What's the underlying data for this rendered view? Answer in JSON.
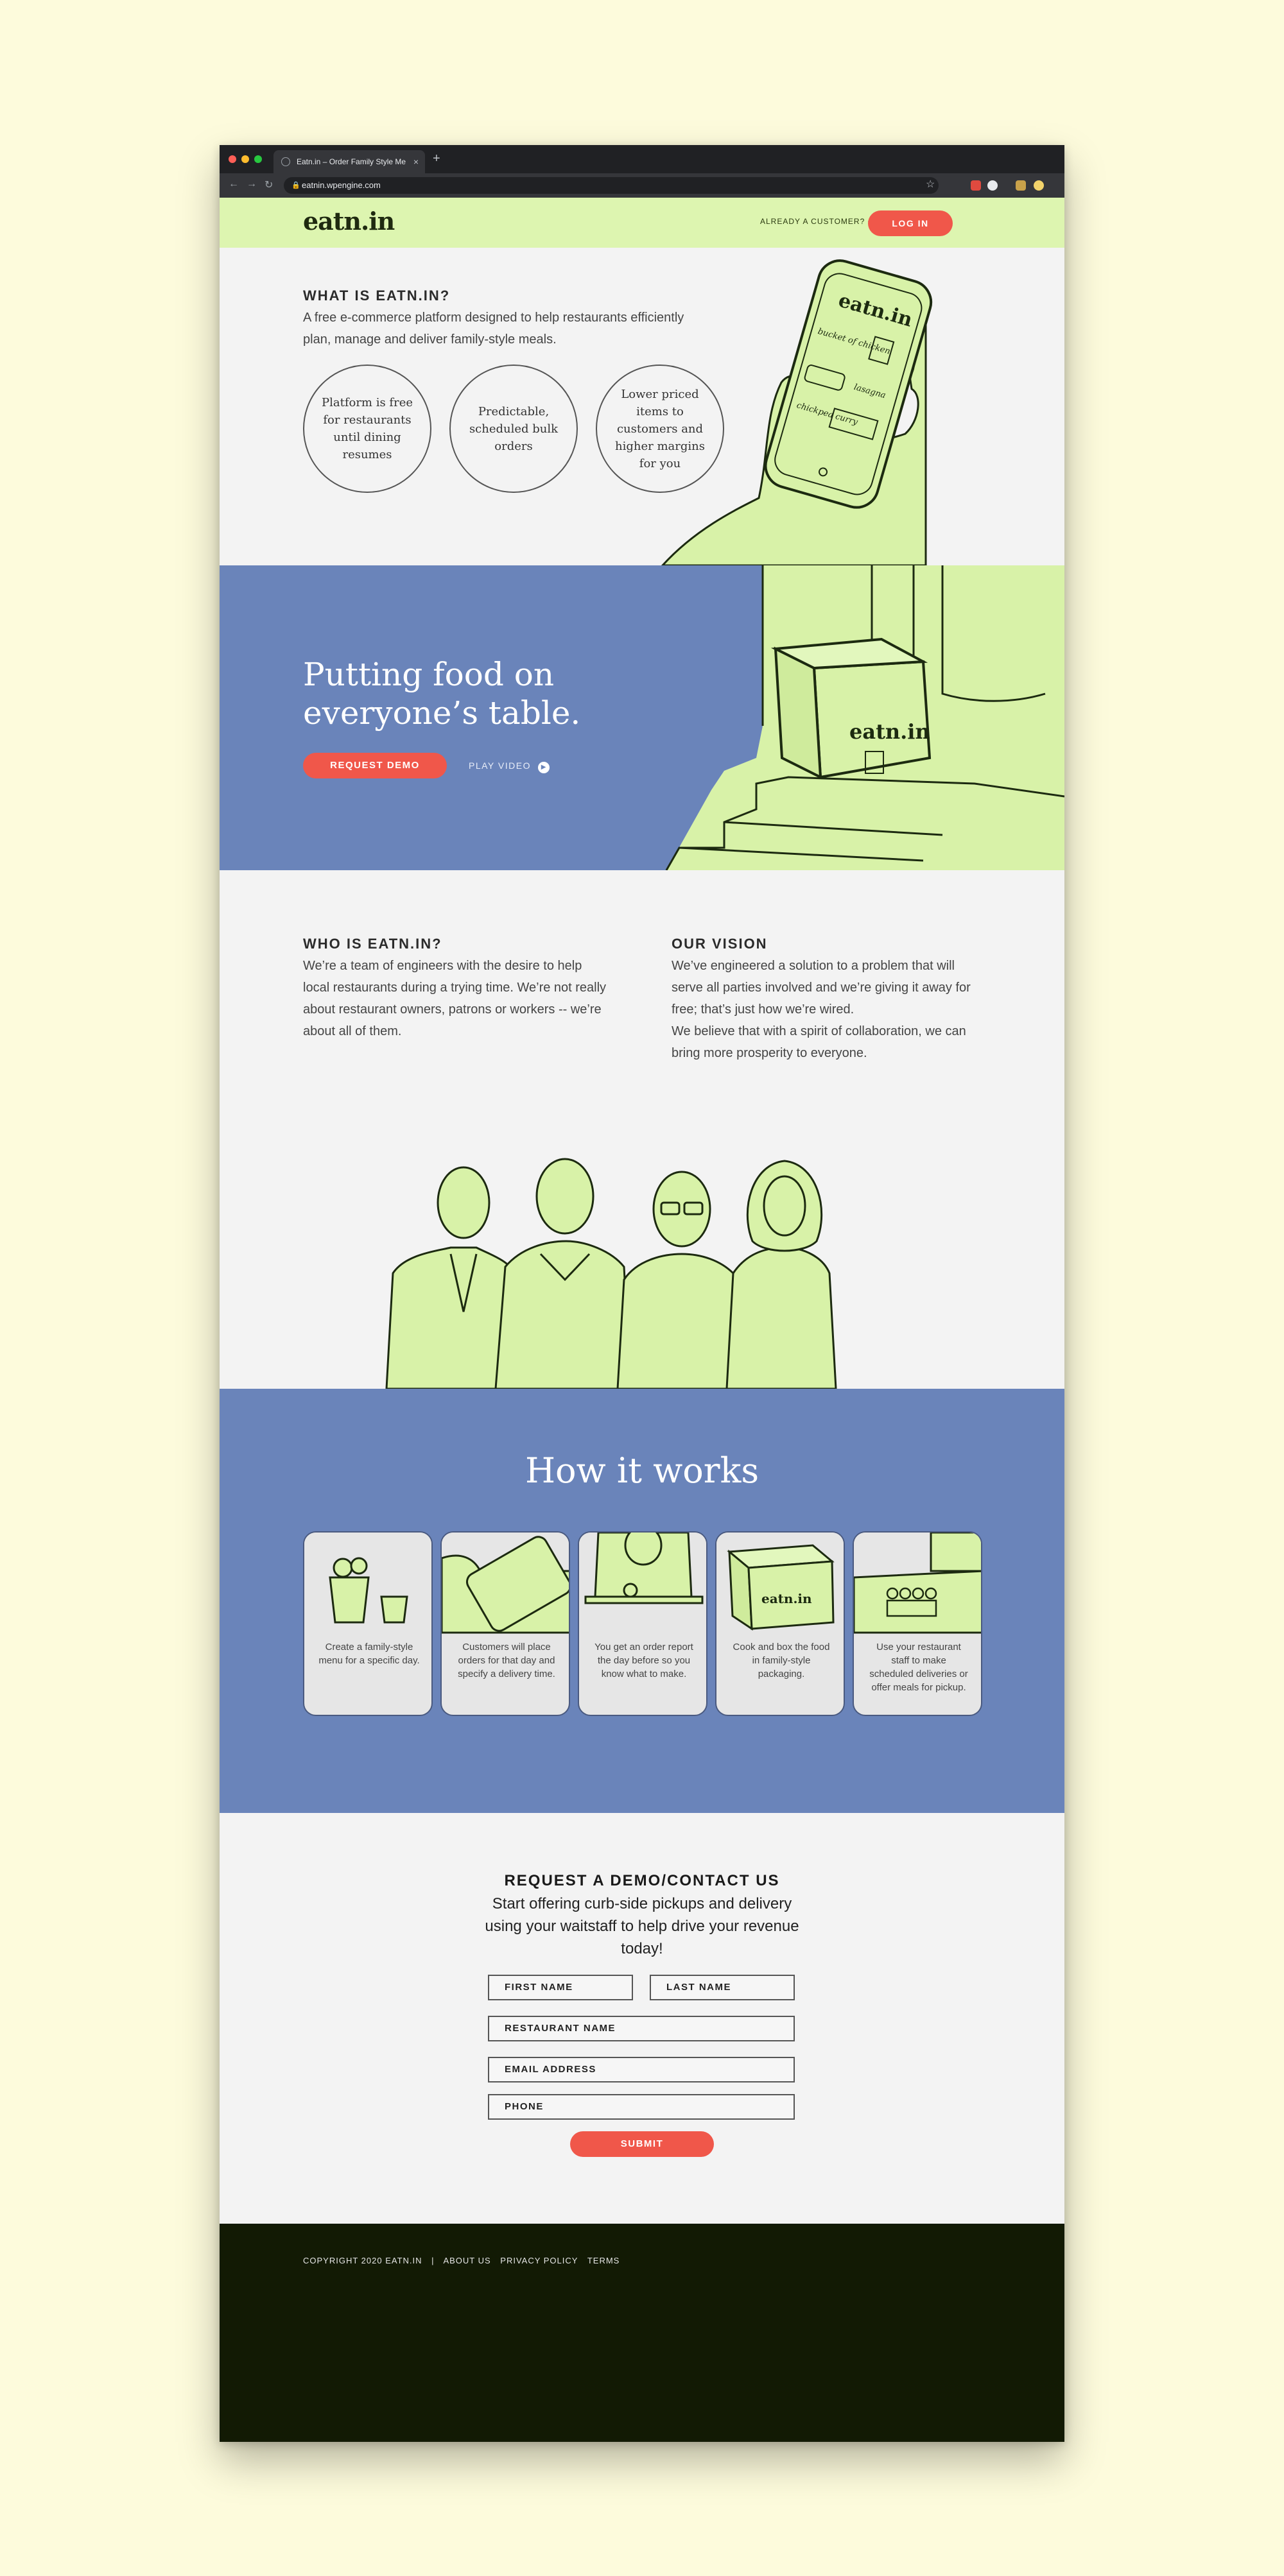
{
  "browser": {
    "tab_title": "Eatn.in – Order Family Style Me",
    "tab_close": "×",
    "new_tab": "+",
    "url": "eatnin.wpengine.com"
  },
  "header": {
    "logo": "eatn.in",
    "already_customer": "ALREADY A CUSTOMER?",
    "login": "LOG IN"
  },
  "what": {
    "heading": "WHAT IS EATN.IN?",
    "description": "A free e-commerce platform designed to help restaurants efficiently plan, manage and deliver family-style meals.",
    "circles": [
      "Platform is free for restaurants until dining resumes",
      "Predictable, scheduled bulk orders",
      "Lower priced items to customers and higher margins for you"
    ],
    "phone": {
      "logo": "eatn.in",
      "item1": "bucket of chicken",
      "item2": "lasagna",
      "item3": "chickpea curry"
    }
  },
  "hero": {
    "title": "Putting food on everyone’s table.",
    "request_demo": "REQUEST DEMO",
    "play_video": "PLAY VIDEO",
    "box_label": "eatn.in"
  },
  "about": {
    "who_heading": "WHO IS EATN.IN?",
    "who_text": "We’re a team of engineers with the desire to help local restaurants during a trying time. We’re not really about restaurant owners, patrons or workers -- we’re about all of them.",
    "vision_heading": "OUR VISION",
    "vision_text1": "We’ve engineered a solution to a problem that will serve all parties involved and we’re giving it away for free; that’s just how we’re wired.",
    "vision_text2": "We believe that with a spirit of collaboration, we can bring more prosperity to everyone."
  },
  "how": {
    "title": "How it works",
    "steps": [
      "Create a family-style menu for a specific day.",
      "Customers will place orders for that day and specify a delivery time.",
      "You get an order report the day before so you know what to make.",
      "Cook and box the food in family-style packaging.",
      "Use your restaurant staff to make scheduled deliveries or offer meals for pickup."
    ],
    "box_label": "eatn.in"
  },
  "contact": {
    "heading": "REQUEST A DEMO/CONTACT US",
    "text": "Start offering curb-side pickups and delivery using your waitstaff to help drive your revenue today!",
    "first_name": "FIRST NAME",
    "last_name": "LAST NAME",
    "restaurant_name": "RESTAURANT NAME",
    "email": "EMAIL ADDRESS",
    "phone": "PHONE",
    "submit": "SUBMIT"
  },
  "footer": {
    "copyright": "COPYRIGHT 2020 EATN.IN",
    "separator": "|",
    "about": "ABOUT US",
    "privacy": "PRIVACY POLICY",
    "terms": "TERMS"
  },
  "colors": {
    "page_bg": "#fdfbdc",
    "lime": "#ddf5b0",
    "illustration": "#d8f2a8",
    "blue": "#6a84ba",
    "red": "#f0574a",
    "footer": "#121a04"
  }
}
